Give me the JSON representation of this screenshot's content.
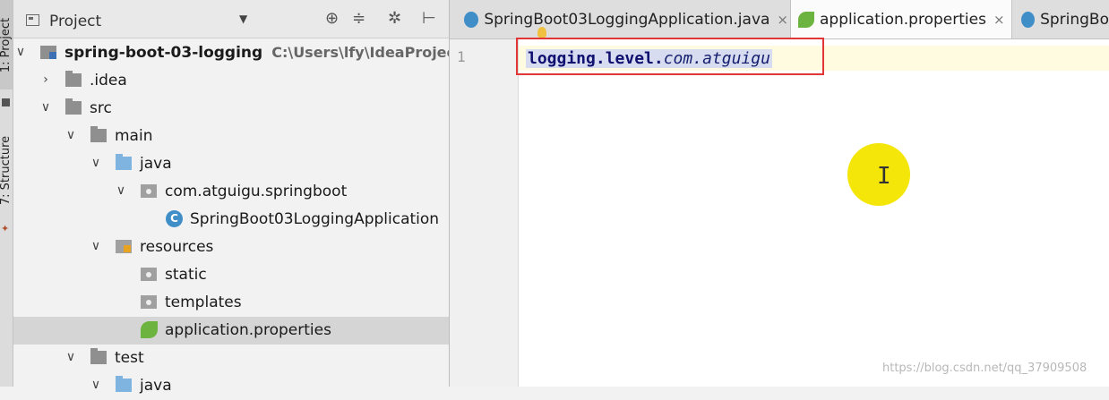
{
  "sidebar_stripe": {
    "project_tab": "1: Project",
    "structure_tab": "7: Structure"
  },
  "panel": {
    "title": "Project",
    "tools": [
      "target-icon",
      "collapse-icon",
      "gear-icon",
      "pin-icon"
    ]
  },
  "tree": [
    {
      "label": "spring-boot-03-logging",
      "path": "C:\\Users\\lfy\\IdeaProjects\\s",
      "icon": "module-icon",
      "arrow": "expanded",
      "depth": 0,
      "bold": true
    },
    {
      "label": ".idea",
      "icon": "folder-icon",
      "arrow": "collapsed",
      "depth": 1
    },
    {
      "label": "src",
      "icon": "folder-icon",
      "arrow": "expanded",
      "depth": 1
    },
    {
      "label": "main",
      "icon": "folder-icon",
      "arrow": "expanded",
      "depth": 2
    },
    {
      "label": "java",
      "icon": "source-folder-icon",
      "arrow": "expanded",
      "depth": 3
    },
    {
      "label": "com.atguigu.springboot",
      "icon": "package-icon",
      "arrow": "expanded",
      "depth": 4
    },
    {
      "label": "SpringBoot03LoggingApplication",
      "icon": "spring-class-icon",
      "arrow": "none",
      "depth": 5
    },
    {
      "label": "resources",
      "icon": "resources-folder-icon",
      "arrow": "expanded",
      "depth": 3
    },
    {
      "label": "static",
      "icon": "package-icon",
      "arrow": "none",
      "depth": 4
    },
    {
      "label": "templates",
      "icon": "package-icon",
      "arrow": "none",
      "depth": 4
    },
    {
      "label": "application.properties",
      "icon": "spring-leaf-icon",
      "arrow": "none",
      "depth": 4,
      "selected": true
    },
    {
      "label": "test",
      "icon": "folder-icon",
      "arrow": "expanded",
      "depth": 2
    },
    {
      "label": "java",
      "icon": "source-folder-icon",
      "arrow": "expanded",
      "depth": 3
    }
  ],
  "tabs": [
    {
      "label": "SpringBoot03LoggingApplication.java",
      "icon": "spring-class-icon",
      "active": false,
      "closable": true
    },
    {
      "label": "application.properties",
      "icon": "spring-leaf-icon",
      "active": true,
      "closable": true
    },
    {
      "label": "SpringBo",
      "icon": "class-icon",
      "active": false,
      "closable": false
    }
  ],
  "editor": {
    "line_number": "1",
    "code_key": "logging.level.",
    "code_value": "com.atguigu"
  },
  "cursor_glyph": "I",
  "watermark": "https://blog.csdn.net/qq_37909508",
  "colors": {
    "annotation_box": "#e23535",
    "cursor_highlight": "#f5e60a",
    "spring_green": "#6db33f"
  }
}
